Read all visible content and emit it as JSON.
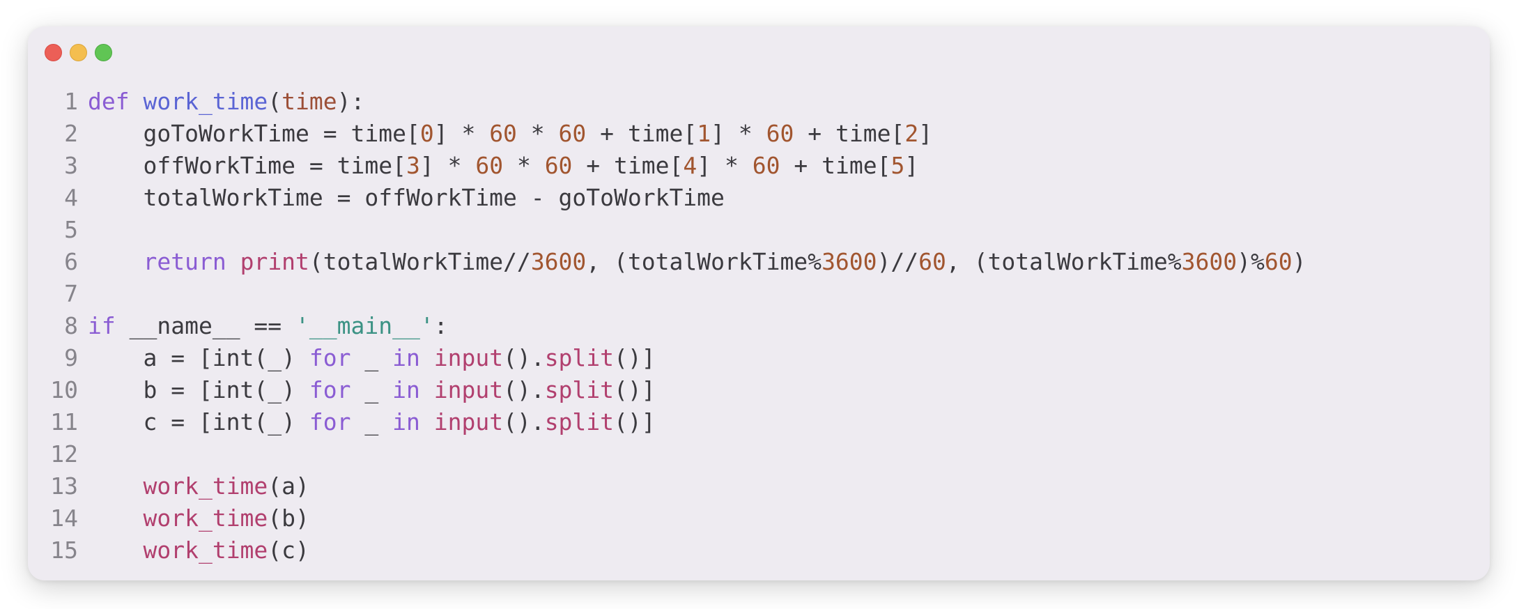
{
  "window": {
    "controls": [
      "close",
      "minimize",
      "maximize"
    ]
  },
  "colors": {
    "background": "#eeebf1",
    "keyword": "#8a5cd3",
    "function_name": "#5a64d4",
    "parameter": "#9c4f37",
    "number": "#a1552f",
    "string": "#3b9284",
    "call": "#b13f6e",
    "text": "#3b3a3f",
    "line_number": "#86848b"
  },
  "code": {
    "lines": [
      {
        "n": "1",
        "tokens": [
          {
            "t": "def",
            "k": "kw"
          },
          {
            "t": " ",
            "k": "text"
          },
          {
            "t": "work_time",
            "k": "fn"
          },
          {
            "t": "(",
            "k": "text"
          },
          {
            "t": "time",
            "k": "param"
          },
          {
            "t": "):",
            "k": "text"
          }
        ]
      },
      {
        "n": "2",
        "tokens": [
          {
            "t": "    goToWorkTime = time[",
            "k": "text"
          },
          {
            "t": "0",
            "k": "num"
          },
          {
            "t": "] * ",
            "k": "text"
          },
          {
            "t": "60",
            "k": "num"
          },
          {
            "t": " * ",
            "k": "text"
          },
          {
            "t": "60",
            "k": "num"
          },
          {
            "t": " + time[",
            "k": "text"
          },
          {
            "t": "1",
            "k": "num"
          },
          {
            "t": "] * ",
            "k": "text"
          },
          {
            "t": "60",
            "k": "num"
          },
          {
            "t": " + time[",
            "k": "text"
          },
          {
            "t": "2",
            "k": "num"
          },
          {
            "t": "]",
            "k": "text"
          }
        ]
      },
      {
        "n": "3",
        "tokens": [
          {
            "t": "    offWorkTime = time[",
            "k": "text"
          },
          {
            "t": "3",
            "k": "num"
          },
          {
            "t": "] * ",
            "k": "text"
          },
          {
            "t": "60",
            "k": "num"
          },
          {
            "t": " * ",
            "k": "text"
          },
          {
            "t": "60",
            "k": "num"
          },
          {
            "t": " + time[",
            "k": "text"
          },
          {
            "t": "4",
            "k": "num"
          },
          {
            "t": "] * ",
            "k": "text"
          },
          {
            "t": "60",
            "k": "num"
          },
          {
            "t": " + time[",
            "k": "text"
          },
          {
            "t": "5",
            "k": "num"
          },
          {
            "t": "]",
            "k": "text"
          }
        ]
      },
      {
        "n": "4",
        "tokens": [
          {
            "t": "    totalWorkTime = offWorkTime - goToWorkTime",
            "k": "text"
          }
        ]
      },
      {
        "n": "5",
        "tokens": []
      },
      {
        "n": "6",
        "tokens": [
          {
            "t": "    ",
            "k": "text"
          },
          {
            "t": "return",
            "k": "kw"
          },
          {
            "t": " ",
            "k": "text"
          },
          {
            "t": "print",
            "k": "call"
          },
          {
            "t": "(totalWorkTime//",
            "k": "text"
          },
          {
            "t": "3600",
            "k": "num"
          },
          {
            "t": ", (totalWorkTime%",
            "k": "text"
          },
          {
            "t": "3600",
            "k": "num"
          },
          {
            "t": ")//",
            "k": "text"
          },
          {
            "t": "60",
            "k": "num"
          },
          {
            "t": ", (totalWorkTime%",
            "k": "text"
          },
          {
            "t": "3600",
            "k": "num"
          },
          {
            "t": ")%",
            "k": "text"
          },
          {
            "t": "60",
            "k": "num"
          },
          {
            "t": ")",
            "k": "text"
          }
        ]
      },
      {
        "n": "7",
        "tokens": []
      },
      {
        "n": "8",
        "tokens": [
          {
            "t": "if",
            "k": "kw"
          },
          {
            "t": " __name__ == ",
            "k": "text"
          },
          {
            "t": "'__main__'",
            "k": "str"
          },
          {
            "t": ":",
            "k": "text"
          }
        ]
      },
      {
        "n": "9",
        "tokens": [
          {
            "t": "    a = [int(_) ",
            "k": "text"
          },
          {
            "t": "for",
            "k": "kw"
          },
          {
            "t": " _ ",
            "k": "text"
          },
          {
            "t": "in",
            "k": "kw"
          },
          {
            "t": " ",
            "k": "text"
          },
          {
            "t": "input",
            "k": "call"
          },
          {
            "t": "().",
            "k": "text"
          },
          {
            "t": "split",
            "k": "call"
          },
          {
            "t": "()]",
            "k": "text"
          }
        ]
      },
      {
        "n": "10",
        "tokens": [
          {
            "t": "    b = [int(_) ",
            "k": "text"
          },
          {
            "t": "for",
            "k": "kw"
          },
          {
            "t": " _ ",
            "k": "text"
          },
          {
            "t": "in",
            "k": "kw"
          },
          {
            "t": " ",
            "k": "text"
          },
          {
            "t": "input",
            "k": "call"
          },
          {
            "t": "().",
            "k": "text"
          },
          {
            "t": "split",
            "k": "call"
          },
          {
            "t": "()]",
            "k": "text"
          }
        ]
      },
      {
        "n": "11",
        "tokens": [
          {
            "t": "    c = [int(_) ",
            "k": "text"
          },
          {
            "t": "for",
            "k": "kw"
          },
          {
            "t": " _ ",
            "k": "text"
          },
          {
            "t": "in",
            "k": "kw"
          },
          {
            "t": " ",
            "k": "text"
          },
          {
            "t": "input",
            "k": "call"
          },
          {
            "t": "().",
            "k": "text"
          },
          {
            "t": "split",
            "k": "call"
          },
          {
            "t": "()]",
            "k": "text"
          }
        ]
      },
      {
        "n": "12",
        "tokens": []
      },
      {
        "n": "13",
        "tokens": [
          {
            "t": "    ",
            "k": "text"
          },
          {
            "t": "work_time",
            "k": "call"
          },
          {
            "t": "(a)",
            "k": "text"
          }
        ]
      },
      {
        "n": "14",
        "tokens": [
          {
            "t": "    ",
            "k": "text"
          },
          {
            "t": "work_time",
            "k": "call"
          },
          {
            "t": "(b)",
            "k": "text"
          }
        ]
      },
      {
        "n": "15",
        "tokens": [
          {
            "t": "    ",
            "k": "text"
          },
          {
            "t": "work_time",
            "k": "call"
          },
          {
            "t": "(c)",
            "k": "text"
          }
        ]
      }
    ]
  }
}
